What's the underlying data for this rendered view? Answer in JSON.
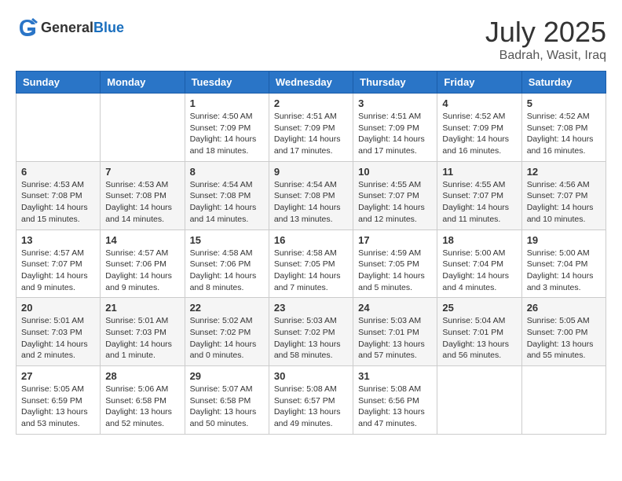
{
  "header": {
    "logo_general": "General",
    "logo_blue": "Blue",
    "month_year": "July 2025",
    "location": "Badrah, Wasit, Iraq"
  },
  "days_of_week": [
    "Sunday",
    "Monday",
    "Tuesday",
    "Wednesday",
    "Thursday",
    "Friday",
    "Saturday"
  ],
  "weeks": [
    [
      {
        "day": "",
        "info": ""
      },
      {
        "day": "",
        "info": ""
      },
      {
        "day": "1",
        "info": "Sunrise: 4:50 AM\nSunset: 7:09 PM\nDaylight: 14 hours and 18 minutes."
      },
      {
        "day": "2",
        "info": "Sunrise: 4:51 AM\nSunset: 7:09 PM\nDaylight: 14 hours and 17 minutes."
      },
      {
        "day": "3",
        "info": "Sunrise: 4:51 AM\nSunset: 7:09 PM\nDaylight: 14 hours and 17 minutes."
      },
      {
        "day": "4",
        "info": "Sunrise: 4:52 AM\nSunset: 7:09 PM\nDaylight: 14 hours and 16 minutes."
      },
      {
        "day": "5",
        "info": "Sunrise: 4:52 AM\nSunset: 7:08 PM\nDaylight: 14 hours and 16 minutes."
      }
    ],
    [
      {
        "day": "6",
        "info": "Sunrise: 4:53 AM\nSunset: 7:08 PM\nDaylight: 14 hours and 15 minutes."
      },
      {
        "day": "7",
        "info": "Sunrise: 4:53 AM\nSunset: 7:08 PM\nDaylight: 14 hours and 14 minutes."
      },
      {
        "day": "8",
        "info": "Sunrise: 4:54 AM\nSunset: 7:08 PM\nDaylight: 14 hours and 14 minutes."
      },
      {
        "day": "9",
        "info": "Sunrise: 4:54 AM\nSunset: 7:08 PM\nDaylight: 14 hours and 13 minutes."
      },
      {
        "day": "10",
        "info": "Sunrise: 4:55 AM\nSunset: 7:07 PM\nDaylight: 14 hours and 12 minutes."
      },
      {
        "day": "11",
        "info": "Sunrise: 4:55 AM\nSunset: 7:07 PM\nDaylight: 14 hours and 11 minutes."
      },
      {
        "day": "12",
        "info": "Sunrise: 4:56 AM\nSunset: 7:07 PM\nDaylight: 14 hours and 10 minutes."
      }
    ],
    [
      {
        "day": "13",
        "info": "Sunrise: 4:57 AM\nSunset: 7:07 PM\nDaylight: 14 hours and 9 minutes."
      },
      {
        "day": "14",
        "info": "Sunrise: 4:57 AM\nSunset: 7:06 PM\nDaylight: 14 hours and 9 minutes."
      },
      {
        "day": "15",
        "info": "Sunrise: 4:58 AM\nSunset: 7:06 PM\nDaylight: 14 hours and 8 minutes."
      },
      {
        "day": "16",
        "info": "Sunrise: 4:58 AM\nSunset: 7:05 PM\nDaylight: 14 hours and 7 minutes."
      },
      {
        "day": "17",
        "info": "Sunrise: 4:59 AM\nSunset: 7:05 PM\nDaylight: 14 hours and 5 minutes."
      },
      {
        "day": "18",
        "info": "Sunrise: 5:00 AM\nSunset: 7:04 PM\nDaylight: 14 hours and 4 minutes."
      },
      {
        "day": "19",
        "info": "Sunrise: 5:00 AM\nSunset: 7:04 PM\nDaylight: 14 hours and 3 minutes."
      }
    ],
    [
      {
        "day": "20",
        "info": "Sunrise: 5:01 AM\nSunset: 7:03 PM\nDaylight: 14 hours and 2 minutes."
      },
      {
        "day": "21",
        "info": "Sunrise: 5:01 AM\nSunset: 7:03 PM\nDaylight: 14 hours and 1 minute."
      },
      {
        "day": "22",
        "info": "Sunrise: 5:02 AM\nSunset: 7:02 PM\nDaylight: 14 hours and 0 minutes."
      },
      {
        "day": "23",
        "info": "Sunrise: 5:03 AM\nSunset: 7:02 PM\nDaylight: 13 hours and 58 minutes."
      },
      {
        "day": "24",
        "info": "Sunrise: 5:03 AM\nSunset: 7:01 PM\nDaylight: 13 hours and 57 minutes."
      },
      {
        "day": "25",
        "info": "Sunrise: 5:04 AM\nSunset: 7:01 PM\nDaylight: 13 hours and 56 minutes."
      },
      {
        "day": "26",
        "info": "Sunrise: 5:05 AM\nSunset: 7:00 PM\nDaylight: 13 hours and 55 minutes."
      }
    ],
    [
      {
        "day": "27",
        "info": "Sunrise: 5:05 AM\nSunset: 6:59 PM\nDaylight: 13 hours and 53 minutes."
      },
      {
        "day": "28",
        "info": "Sunrise: 5:06 AM\nSunset: 6:58 PM\nDaylight: 13 hours and 52 minutes."
      },
      {
        "day": "29",
        "info": "Sunrise: 5:07 AM\nSunset: 6:58 PM\nDaylight: 13 hours and 50 minutes."
      },
      {
        "day": "30",
        "info": "Sunrise: 5:08 AM\nSunset: 6:57 PM\nDaylight: 13 hours and 49 minutes."
      },
      {
        "day": "31",
        "info": "Sunrise: 5:08 AM\nSunset: 6:56 PM\nDaylight: 13 hours and 47 minutes."
      },
      {
        "day": "",
        "info": ""
      },
      {
        "day": "",
        "info": ""
      }
    ]
  ]
}
